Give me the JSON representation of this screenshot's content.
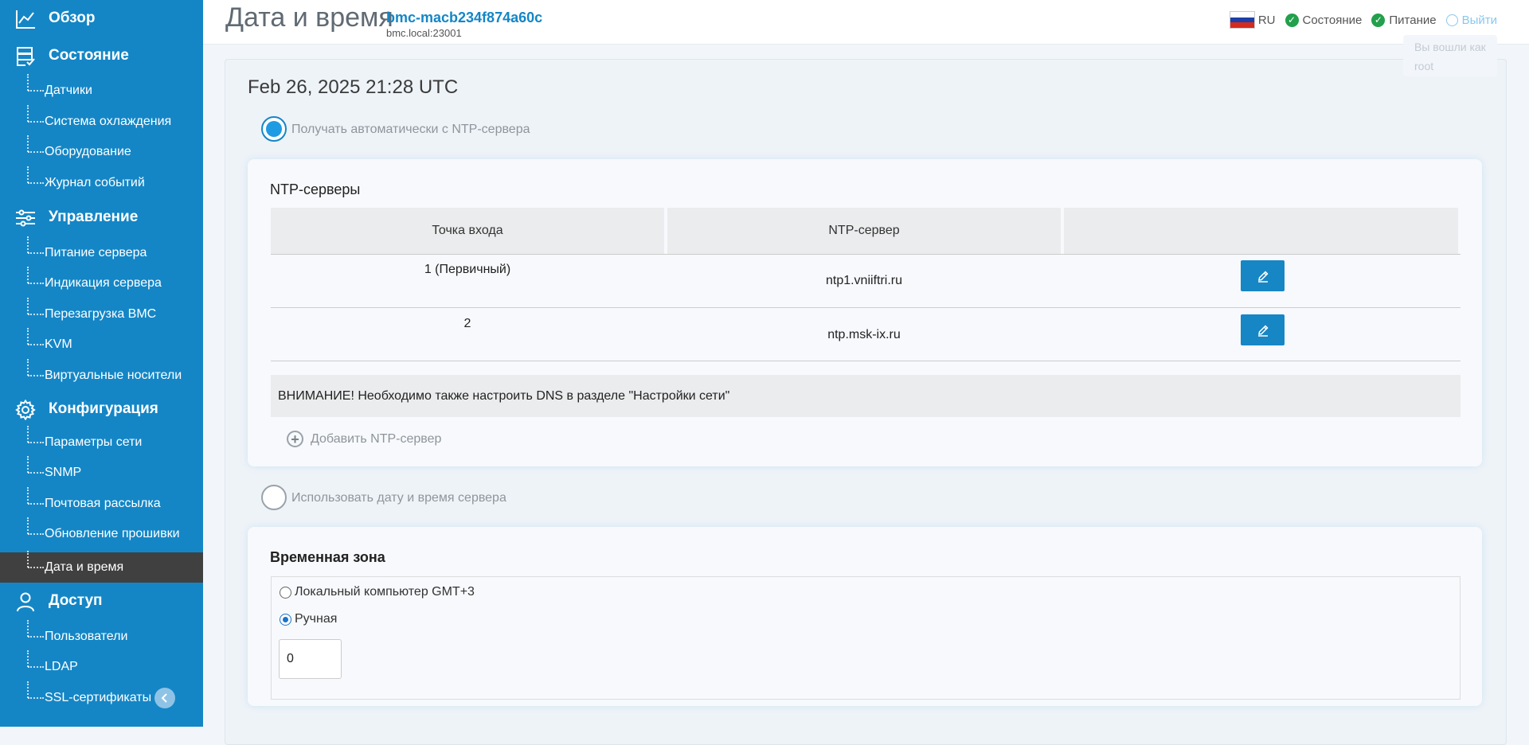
{
  "sidebar": {
    "sections": [
      {
        "label": "Обзор",
        "icon": "chart-icon",
        "items": []
      },
      {
        "label": "Состояние",
        "icon": "server-status-icon",
        "items": [
          "Датчики",
          "Система охлаждения",
          "Оборудование",
          "Журнал событий"
        ]
      },
      {
        "label": "Управление",
        "icon": "sliders-icon",
        "items": [
          "Питание сервера",
          "Индикация сервера",
          "Перезагрузка BMC",
          "KVM",
          "Виртуальные носители"
        ]
      },
      {
        "label": "Конфигурация",
        "icon": "gear-icon",
        "items": [
          "Параметры сети",
          "SNMP",
          "Почтовая рассылка",
          "Обновление прошивки",
          "Дата и время"
        ]
      },
      {
        "label": "Доступ",
        "icon": "user-icon",
        "items": [
          "Пользователи",
          "LDAP",
          "SSL-сертификаты"
        ]
      }
    ],
    "active_item": "Дата и время"
  },
  "header": {
    "title": "Дата и время",
    "host": "bmc-macb234f874a60c",
    "host_sub": "bmc.local:23001",
    "lang": "RU",
    "status": "Состояние",
    "power": "Питание",
    "logout": "Выйти",
    "tooltip_line1": "Вы вошли как",
    "tooltip_line2": "root"
  },
  "main": {
    "datetime": "Feb 26, 2025 21:28 UTC",
    "ntp_option": "Получать автоматически с NTP-сервера",
    "ntp_option_selected": true,
    "ntp_section": {
      "title": "NTP-серверы",
      "columns": [
        "Точка входа",
        "NTP-сервер",
        ""
      ],
      "rows": [
        {
          "entry": "1 (Первичный)",
          "server": "ntp1.vniiftri.ru"
        },
        {
          "entry": "2",
          "server": "ntp.msk-ix.ru"
        }
      ],
      "warning": "ВНИМАНИЕ! Необходимо также настроить DNS в разделе \"Настройки сети\"",
      "add_label": "Добавить NTP-сервер"
    },
    "server_option": "Использовать дату и время сервера",
    "server_option_selected": false,
    "timezone": {
      "title": "Временная зона",
      "local_label": "Локальный компьютер GMT+3",
      "manual_label": "Ручная",
      "selected": "manual",
      "offset_value": "0"
    }
  },
  "colors": {
    "sidebar": "#1486c6",
    "active_item": "#404040",
    "accent": "#1486c6",
    "ok": "#22a04b"
  }
}
